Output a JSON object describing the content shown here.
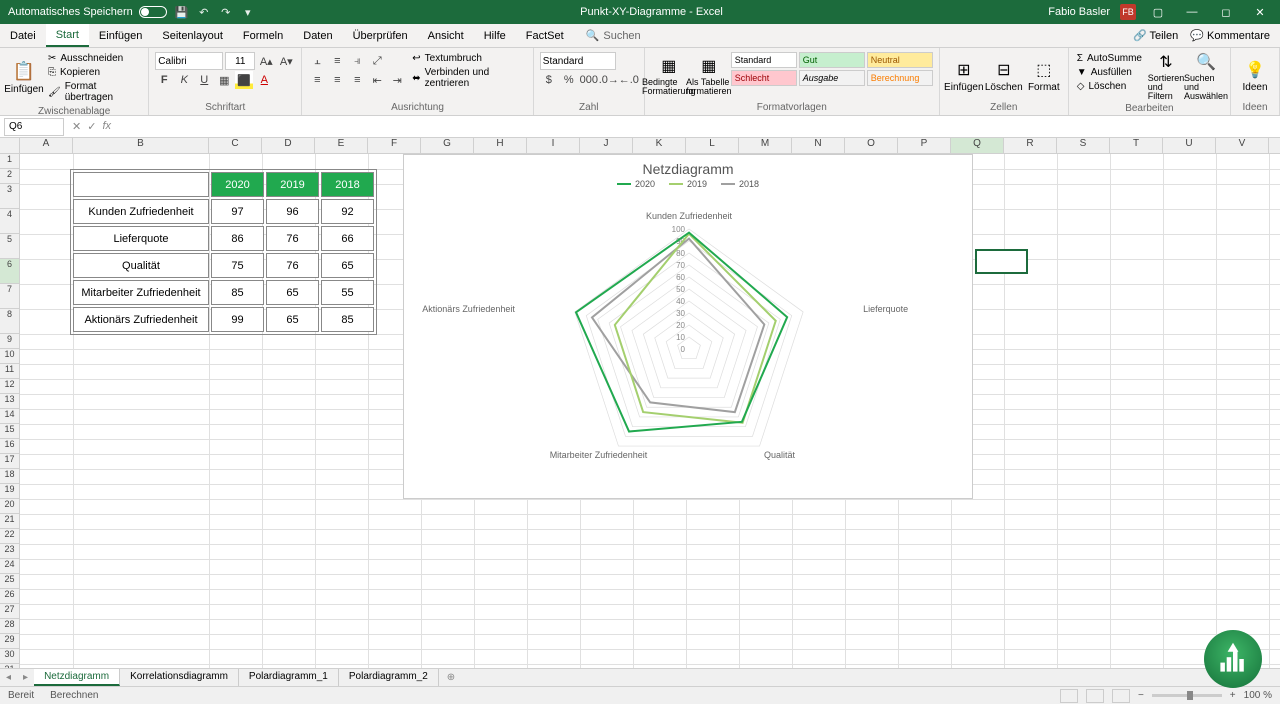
{
  "titlebar": {
    "autosave": "Automatisches Speichern",
    "doc_title": "Punkt-XY-Diagramme - Excel",
    "user": "Fabio Basler",
    "user_initials": "FB"
  },
  "tabs": {
    "datei": "Datei",
    "start": "Start",
    "einfuegen": "Einfügen",
    "seitenlayout": "Seitenlayout",
    "formeln": "Formeln",
    "daten": "Daten",
    "ueberpruefen": "Überprüfen",
    "ansicht": "Ansicht",
    "hilfe": "Hilfe",
    "factset": "FactSet",
    "suchen": "Suchen",
    "teilen": "Teilen",
    "kommentare": "Kommentare"
  },
  "ribbon": {
    "einfuegen": "Einfügen",
    "ausschneiden": "Ausschneiden",
    "kopieren": "Kopieren",
    "format_uebertragen": "Format übertragen",
    "zwischenablage": "Zwischenablage",
    "font_name": "Calibri",
    "font_size": "11",
    "schriftart": "Schriftart",
    "textumbruch": "Textumbruch",
    "verbinden": "Verbinden und zentrieren",
    "ausrichtung": "Ausrichtung",
    "number_format": "Standard",
    "zahl": "Zahl",
    "bedingte": "Bedingte Formatierung",
    "als_tabelle": "Als Tabelle formatieren",
    "style_standard": "Standard",
    "style_gut": "Gut",
    "style_neutral": "Neutral",
    "style_schlecht": "Schlecht",
    "style_ausgabe": "Ausgabe",
    "style_berechnung": "Berechnung",
    "formatvorlagen": "Formatvorlagen",
    "zellen_einfuegen": "Einfügen",
    "loeschen": "Löschen",
    "format": "Format",
    "zellen": "Zellen",
    "autosumme": "AutoSumme",
    "ausfuellen": "Ausfüllen",
    "loeschen2": "Löschen",
    "sortieren": "Sortieren und Filtern",
    "suchen_auswaehlen": "Suchen und Auswählen",
    "bearbeiten": "Bearbeiten",
    "ideen": "Ideen"
  },
  "formula": {
    "cell_ref": "Q6",
    "value": ""
  },
  "columns": [
    "A",
    "B",
    "C",
    "D",
    "E",
    "F",
    "G",
    "H",
    "I",
    "J",
    "K",
    "L",
    "M",
    "N",
    "O",
    "P",
    "Q",
    "R",
    "S",
    "T",
    "U",
    "V"
  ],
  "table": {
    "headers": [
      "2020",
      "2019",
      "2018"
    ],
    "rows": [
      {
        "label": "Kunden Zufriedenheit",
        "values": [
          "97",
          "96",
          "92"
        ]
      },
      {
        "label": "Lieferquote",
        "values": [
          "86",
          "76",
          "66"
        ]
      },
      {
        "label": "Qualität",
        "values": [
          "75",
          "76",
          "65"
        ]
      },
      {
        "label": "Mitarbeiter Zufriedenheit",
        "values": [
          "85",
          "65",
          "55"
        ]
      },
      {
        "label": "Aktionärs Zufriedenheit",
        "values": [
          "99",
          "65",
          "85"
        ]
      }
    ]
  },
  "chart_data": {
    "type": "radar",
    "title": "Netzdiagramm",
    "categories": [
      "Kunden Zufriedenheit",
      "Lieferquote",
      "Qualität",
      "Mitarbeiter Zufriedenheit",
      "Aktionärs Zufriedenheit"
    ],
    "series": [
      {
        "name": "2020",
        "color": "#21a94f",
        "values": [
          97,
          86,
          75,
          85,
          99
        ]
      },
      {
        "name": "2019",
        "color": "#a4cf6e",
        "values": [
          96,
          76,
          76,
          65,
          65
        ]
      },
      {
        "name": "2018",
        "color": "#a0a0a0",
        "values": [
          92,
          66,
          65,
          55,
          85
        ]
      }
    ],
    "ticks": [
      0,
      10,
      20,
      30,
      40,
      50,
      60,
      70,
      80,
      90,
      100
    ],
    "max": 100
  },
  "sheets": {
    "items": [
      "Netzdiagramm",
      "Korrelationsdiagramm",
      "Polardiagramm_1",
      "Polardiagramm_2"
    ],
    "active": 0
  },
  "status": {
    "bereit": "Bereit",
    "berechnen": "Berechnen",
    "zoom": "100 %"
  }
}
